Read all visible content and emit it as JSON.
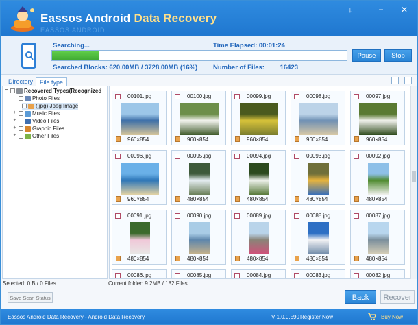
{
  "app": {
    "title_main": "Eassos Android ",
    "title_accent": "Data Recovery",
    "title_ghost": "EASSOS ANDROID",
    "window_controls": [
      "↓",
      "−",
      "✕"
    ]
  },
  "scan": {
    "searching_label": "Searching...",
    "time_elapsed": "Time Elapsed: 00:01:24",
    "progress": 0.16,
    "searched_blocks": "Searched Blocks: 620.00MB / 3728.00MB (16%)",
    "number_of_files_label": "Number of Files:",
    "number_of_files_value": "16423",
    "pause_label": "Pause",
    "stop_label": "Stop"
  },
  "tabs": [
    {
      "label": "Directory",
      "active": false
    },
    {
      "label": "File type",
      "active": true
    }
  ],
  "tree": [
    {
      "label": "Recovered Types(Recognized",
      "level": 0,
      "icon": "drive-icon",
      "bold": true
    },
    {
      "label": "Photo Files",
      "level": 1,
      "icon": "photo-folder-icon"
    },
    {
      "label": "(.jpg) Jpeg Image",
      "level": 2,
      "icon": "jpeg-icon",
      "highlighted": true
    },
    {
      "label": "Music Files",
      "level": 1,
      "icon": "music-folder-icon"
    },
    {
      "label": "Video Files",
      "level": 1,
      "icon": "video-folder-icon"
    },
    {
      "label": "Graphic Files",
      "level": 1,
      "icon": "graphic-folder-icon"
    },
    {
      "label": "Other Files",
      "level": 1,
      "icon": "other-folder-icon"
    }
  ],
  "files": [
    {
      "name": "00101.jpg",
      "dim": "960×854",
      "orient": "landscape",
      "colors": [
        "#9cc6e8",
        "#3d6fa8",
        "#d6c59a"
      ]
    },
    {
      "name": "00100.jpg",
      "dim": "960×854",
      "orient": "landscape",
      "colors": [
        "#6d8f4a",
        "#f4f4f0",
        "#3f5a2a"
      ]
    },
    {
      "name": "00099.jpg",
      "dim": "960×854",
      "orient": "landscape",
      "colors": [
        "#4a5a1e",
        "#d8c33a",
        "#7a7d2e"
      ]
    },
    {
      "name": "00098.jpg",
      "dim": "960×854",
      "orient": "landscape",
      "colors": [
        "#bcd3e8",
        "#6f90b4",
        "#d8c9a6"
      ]
    },
    {
      "name": "00097.jpg",
      "dim": "960×854",
      "orient": "landscape",
      "colors": [
        "#5a7a32",
        "#f2f2ee",
        "#2e4a1c"
      ]
    },
    {
      "name": "00096.jpg",
      "dim": "960×854",
      "orient": "landscape",
      "colors": [
        "#6ab0e8",
        "#2d76b8",
        "#e2d2a4"
      ]
    },
    {
      "name": "00095.jpg",
      "dim": "480×854",
      "orient": "portrait",
      "colors": [
        "#3e5a3a",
        "#e6eef2",
        "#6a7f58"
      ]
    },
    {
      "name": "00094.jpg",
      "dim": "480×854",
      "orient": "portrait",
      "colors": [
        "#2c4a1e",
        "#eef2ec",
        "#587a3a"
      ]
    },
    {
      "name": "00093.jpg",
      "dim": "480×854",
      "orient": "portrait",
      "colors": [
        "#6f6f3a",
        "#e8b43c",
        "#3a6fb8"
      ]
    },
    {
      "name": "00092.jpg",
      "dim": "480×854",
      "orient": "portrait",
      "colors": [
        "#8ec0e8",
        "#4e8a2e",
        "#f0f0ec"
      ]
    },
    {
      "name": "00091.jpg",
      "dim": "480×854",
      "orient": "portrait",
      "colors": [
        "#3c6a2c",
        "#f0c8d8",
        "#e8e8e6"
      ]
    },
    {
      "name": "00090.jpg",
      "dim": "480×854",
      "orient": "portrait",
      "colors": [
        "#a9cce6",
        "#5e86ac",
        "#c8b38a"
      ]
    },
    {
      "name": "00089.jpg",
      "dim": "480×854",
      "orient": "portrait",
      "colors": [
        "#b9d4ea",
        "#8a8478",
        "#d24f7a"
      ]
    },
    {
      "name": "00088.jpg",
      "dim": "480×854",
      "orient": "portrait",
      "colors": [
        "#2d6fc4",
        "#f2f2f4",
        "#6e8aa8"
      ]
    },
    {
      "name": "00087.jpg",
      "dim": "480×854",
      "orient": "portrait",
      "colors": [
        "#b8d6ee",
        "#7b8f9c",
        "#d8d0b8"
      ]
    },
    {
      "name": "00086.jpg",
      "dim": "",
      "orient": "landscape",
      "colors": [
        "#ccc",
        "#bbb",
        "#aaa"
      ]
    },
    {
      "name": "00085.jpg",
      "dim": "",
      "orient": "landscape",
      "colors": [
        "#ccc",
        "#bbb",
        "#aaa"
      ]
    },
    {
      "name": "00084.jpg",
      "dim": "",
      "orient": "landscape",
      "colors": [
        "#ccc",
        "#bbb",
        "#aaa"
      ]
    },
    {
      "name": "00083.jpg",
      "dim": "",
      "orient": "landscape",
      "colors": [
        "#ccc",
        "#bbb",
        "#aaa"
      ]
    },
    {
      "name": "00082.jpg",
      "dim": "",
      "orient": "landscape",
      "colors": [
        "#ccc",
        "#bbb",
        "#aaa"
      ]
    }
  ],
  "status": {
    "selected": "Selected: 0 B / 0 Files.",
    "current_folder": "Current folder: 9.2MB / 182 Files."
  },
  "buttons": {
    "save_scan": "Save Scan Status",
    "back": "Back",
    "recover": "Recover"
  },
  "footer": {
    "app_name": "Eassos Android Data Recovery - Android Data Recovery",
    "version": "V 1.0.0.590",
    "register": "Register Now",
    "buy": "Buy Now"
  },
  "colors": {
    "brand_blue": "#2a85d6",
    "progress_green": "#4fbd3a",
    "accent_yellow": "#ffe08a"
  }
}
